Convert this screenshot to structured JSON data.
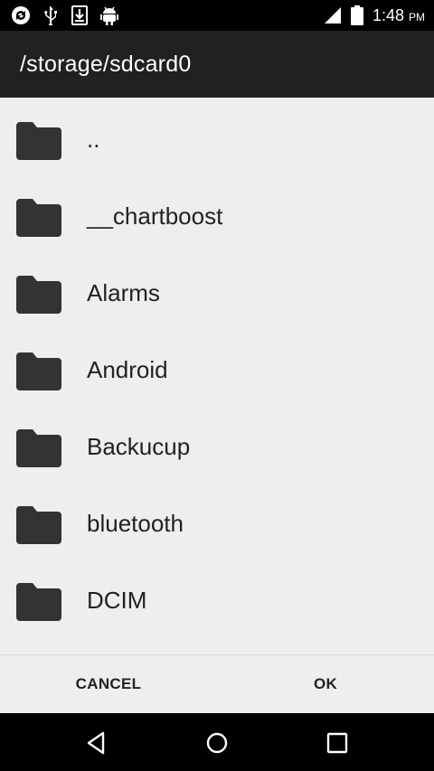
{
  "status_bar": {
    "time": "1:48",
    "ampm": "PM",
    "left_icons": [
      "sync-icon",
      "usb-icon",
      "download-icon",
      "android-debug-icon"
    ],
    "right_icons": [
      "signal-icon",
      "battery-icon"
    ]
  },
  "title": "/storage/sdcard0",
  "folders": [
    {
      "name": "..",
      "icon": "folder-icon"
    },
    {
      "name": "__chartboost",
      "icon": "folder-icon"
    },
    {
      "name": "Alarms",
      "icon": "folder-icon"
    },
    {
      "name": "Android",
      "icon": "folder-icon"
    },
    {
      "name": "Backucup",
      "icon": "folder-icon"
    },
    {
      "name": "bluetooth",
      "icon": "folder-icon"
    },
    {
      "name": "DCIM",
      "icon": "folder-icon"
    }
  ],
  "buttons": {
    "cancel": "CANCEL",
    "ok": "OK"
  },
  "nav": {
    "icons": [
      "back-icon",
      "home-icon",
      "recents-icon"
    ]
  },
  "colors": {
    "title_bar": "#212121",
    "list_background": "#eeeeee",
    "folder_icon": "#333333"
  }
}
